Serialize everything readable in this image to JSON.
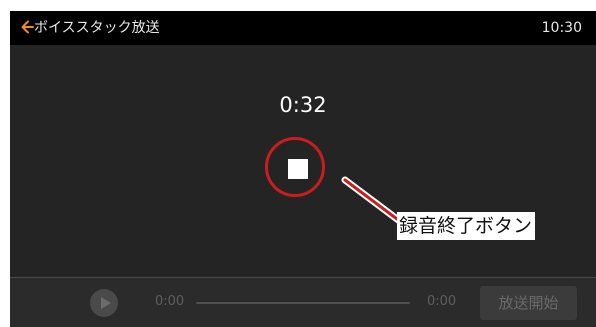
{
  "header": {
    "title": "ボイススタック放送",
    "time": "10:30"
  },
  "recording": {
    "elapsed": "0:32"
  },
  "annotation": {
    "label": "録音終了ボタン"
  },
  "player": {
    "current_time": "0:00",
    "total_time": "0:00",
    "progress": 0,
    "broadcast_label": "放送開始"
  },
  "icons": {
    "back": "back-arrow-icon",
    "stop": "stop-icon",
    "play": "play-icon"
  },
  "colors": {
    "accent_orange": "#f08a24",
    "annotation_red": "#c81e1e"
  }
}
